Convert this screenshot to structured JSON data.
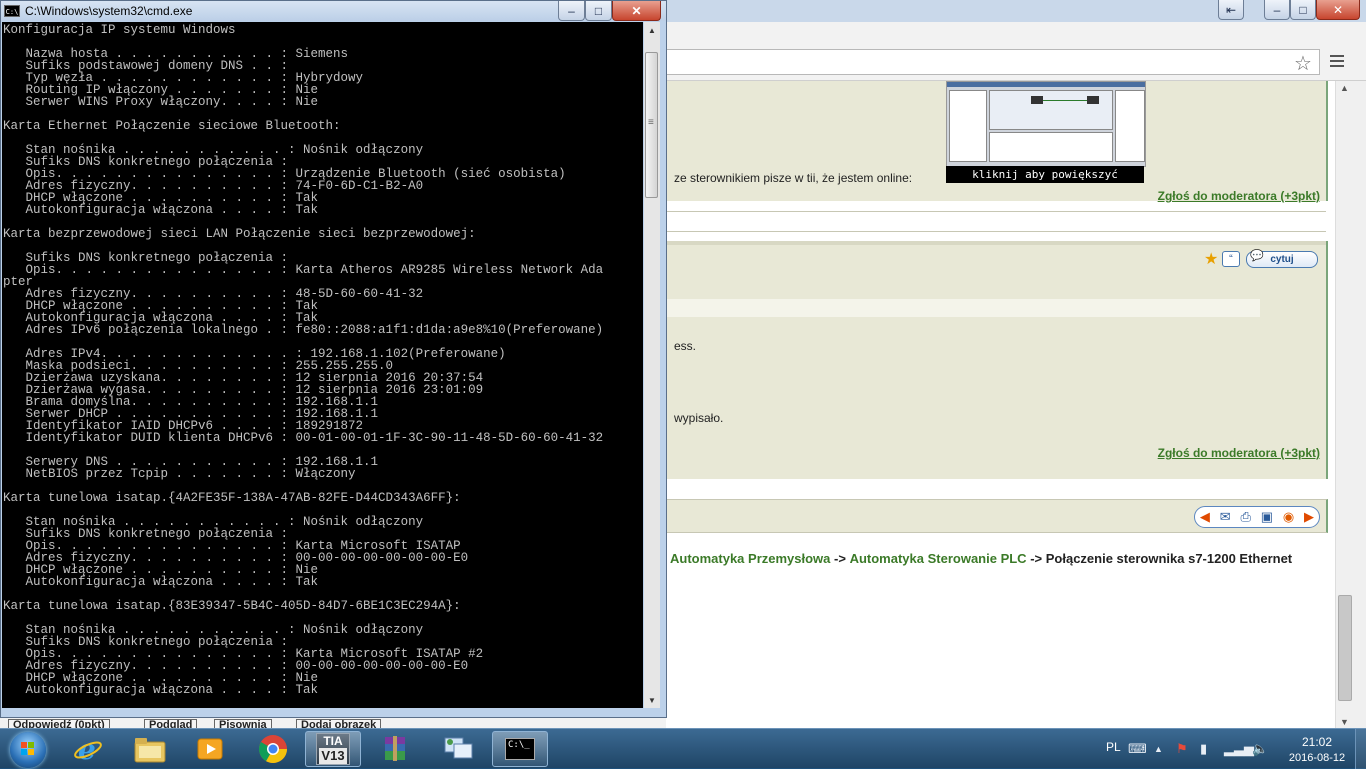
{
  "cmd": {
    "title": "C:\\Windows\\system32\\cmd.exe",
    "icon_text": "C:\\",
    "lines": [
      "Konfiguracja IP systemu Windows",
      "",
      "   Nazwa hosta . . . . . . . . . . . : Siemens",
      "   Sufiks podstawowej domeny DNS . . :",
      "   Typ węzła . . . . . . . . . . . . : Hybrydowy",
      "   Routing IP włączony . . . . . . . : Nie",
      "   Serwer WINS Proxy włączony. . . . : Nie",
      "",
      "Karta Ethernet Połączenie sieciowe Bluetooth:",
      "",
      "   Stan nośnika . . . . . . . . . . . : Nośnik odłączony",
      "   Sufiks DNS konkretnego połączenia :",
      "   Opis. . . . . . . . . . . . . . . : Urządzenie Bluetooth (sieć osobista)",
      "   Adres fizyczny. . . . . . . . . . : 74-F0-6D-C1-B2-A0",
      "   DHCP włączone . . . . . . . . . . : Tak",
      "   Autokonfiguracja włączona . . . . : Tak",
      "",
      "Karta bezprzewodowej sieci LAN Połączenie sieci bezprzewodowej:",
      "",
      "   Sufiks DNS konkretnego połączenia :",
      "   Opis. . . . . . . . . . . . . . . : Karta Atheros AR9285 Wireless Network Ada",
      "pter",
      "   Adres fizyczny. . . . . . . . . . : 48-5D-60-60-41-32",
      "   DHCP włączone . . . . . . . . . . : Tak",
      "   Autokonfiguracja włączona . . . . : Tak",
      "   Adres IPv6 połączenia lokalnego . : fe80::2088:a1f1:d1da:a9e8%10(Preferowane)",
      "",
      "   Adres IPv4. . . . . . . . . . . . . : 192.168.1.102(Preferowane)",
      "   Maska podsieci. . . . . . . . . . : 255.255.255.0",
      "   Dzierżawa uzyskana. . . . . . . . : 12 sierpnia 2016 20:37:54",
      "   Dzierżawa wygasa. . . . . . . . . : 12 sierpnia 2016 23:01:09",
      "   Brama domyślna. . . . . . . . . . : 192.168.1.1",
      "   Serwer DHCP . . . . . . . . . . . : 192.168.1.1",
      "   Identyfikator IAID DHCPv6 . . . . : 189291872",
      "   Identyfikator DUID klienta DHCPv6 : 00-01-00-01-1F-3C-90-11-48-5D-60-60-41-32",
      "",
      "   Serwery DNS . . . . . . . . . . . : 192.168.1.1",
      "   NetBIOS przez Tcpip . . . . . . . : Włączony",
      "",
      "Karta tunelowa isatap.{4A2FE35F-138A-47AB-82FE-D44CD343A6FF}:",
      "",
      "   Stan nośnika . . . . . . . . . . . : Nośnik odłączony",
      "   Sufiks DNS konkretnego połączenia :",
      "   Opis. . . . . . . . . . . . . . . : Karta Microsoft ISATAP",
      "   Adres fizyczny. . . . . . . . . . : 00-00-00-00-00-00-00-E0",
      "   DHCP włączone . . . . . . . . . . : Nie",
      "   Autokonfiguracja włączona . . . . : Tak",
      "",
      "Karta tunelowa isatap.{83E39347-5B4C-405D-84D7-6BE1C3EC294A}:",
      "",
      "   Stan nośnika . . . . . . . . . . . : Nośnik odłączony",
      "   Sufiks DNS konkretnego połączenia :",
      "   Opis. . . . . . . . . . . . . . . : Karta Microsoft ISATAP #2",
      "   Adres fizyczny. . . . . . . . . . : 00-00-00-00-00-00-00-E0",
      "   DHCP włączone . . . . . . . . . . : Nie",
      "   Autokonfiguracja włączona . . . . : Tak"
    ]
  },
  "browser": {
    "post1": {
      "text": "ze sterownikiem pisze w tii, że jestem online:",
      "enlarge_caption": "kliknij aby powiększyć",
      "report_link": "Zgłoś do moderatora (+3pkt)"
    },
    "post2": {
      "quote_button": "cytuj",
      "text1": "ess.",
      "text2": "wypisało.",
      "report_link": "Zgłoś do moderatora (+3pkt)"
    },
    "breadcrumb": {
      "crumb1": "Automatyka Przemysłowa",
      "sep1": "->",
      "crumb2": "Automatyka Sterowanie PLC",
      "sep2": "->",
      "current": "Połączenie sterownika s7-1200 Ethernet"
    },
    "page_buttons": [
      "Odpowiedź (0pkt)",
      "Podgląd",
      "Pisownia",
      "Dodaj obrazek"
    ]
  },
  "taskbar": {
    "apps": [
      "start",
      "internet-explorer",
      "file-explorer",
      "media-player",
      "chrome",
      "tia-portal-v13",
      "winrar",
      "network-settings",
      "cmd"
    ],
    "tia_label_top": "TIA",
    "tia_label_bottom": "V13",
    "cmd_label": "C:\\_",
    "language": "PL",
    "time": "21:02",
    "date": "2016-08-12"
  },
  "colors": {
    "console_bg": "#000000",
    "console_fg": "#c0c0c0",
    "forum_link": "#3b7a28",
    "forum_post_bg": "#e8e8d6",
    "taskbar": "#2b5a82"
  }
}
